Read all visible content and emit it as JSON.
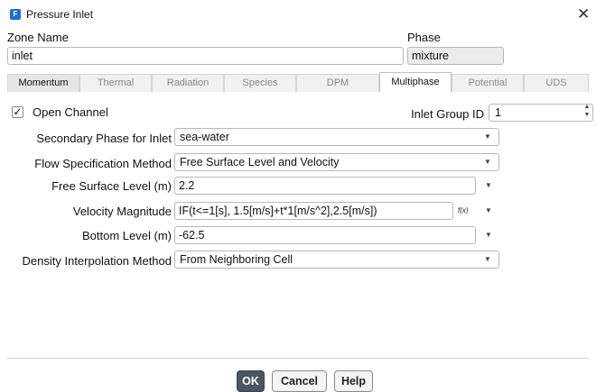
{
  "window": {
    "title": "Pressure Inlet",
    "app_icon_letter": "F"
  },
  "zone": {
    "label": "Zone Name",
    "value": "inlet"
  },
  "phase": {
    "label": "Phase",
    "value": "mixture"
  },
  "tabs": [
    {
      "label": "Momentum"
    },
    {
      "label": "Thermal"
    },
    {
      "label": "Radiation"
    },
    {
      "label": "Species"
    },
    {
      "label": "DPM"
    },
    {
      "label": "Multiphase"
    },
    {
      "label": "Potential"
    },
    {
      "label": "UDS"
    }
  ],
  "active_tab": "Multiphase",
  "open_channel": {
    "label": "Open Channel",
    "checked": true,
    "check_glyph": "✓"
  },
  "inlet_group": {
    "label": "Inlet Group ID",
    "value": "1"
  },
  "secondary_phase": {
    "label": "Secondary Phase for Inlet",
    "value": "sea-water"
  },
  "flow_spec": {
    "label": "Flow Specification Method",
    "value": "Free Surface Level and Velocity"
  },
  "free_surface": {
    "label": "Free Surface Level (m)",
    "value": "2.2"
  },
  "velocity": {
    "label": "Velocity Magnitude",
    "value": "IF(t<=1[s], 1.5[m/s]+t*1[m/s^2],2.5[m/s])",
    "fx_label": "f(x)"
  },
  "bottom_level": {
    "label": "Bottom Level (m)",
    "value": "-62.5"
  },
  "density_interp": {
    "label": "Density Interpolation Method",
    "value": "From Neighboring Cell"
  },
  "buttons": {
    "ok": "OK",
    "cancel": "Cancel",
    "help": "Help"
  },
  "colors": {
    "accent": "#1f6fd1",
    "ok_button": "#4a5664"
  }
}
